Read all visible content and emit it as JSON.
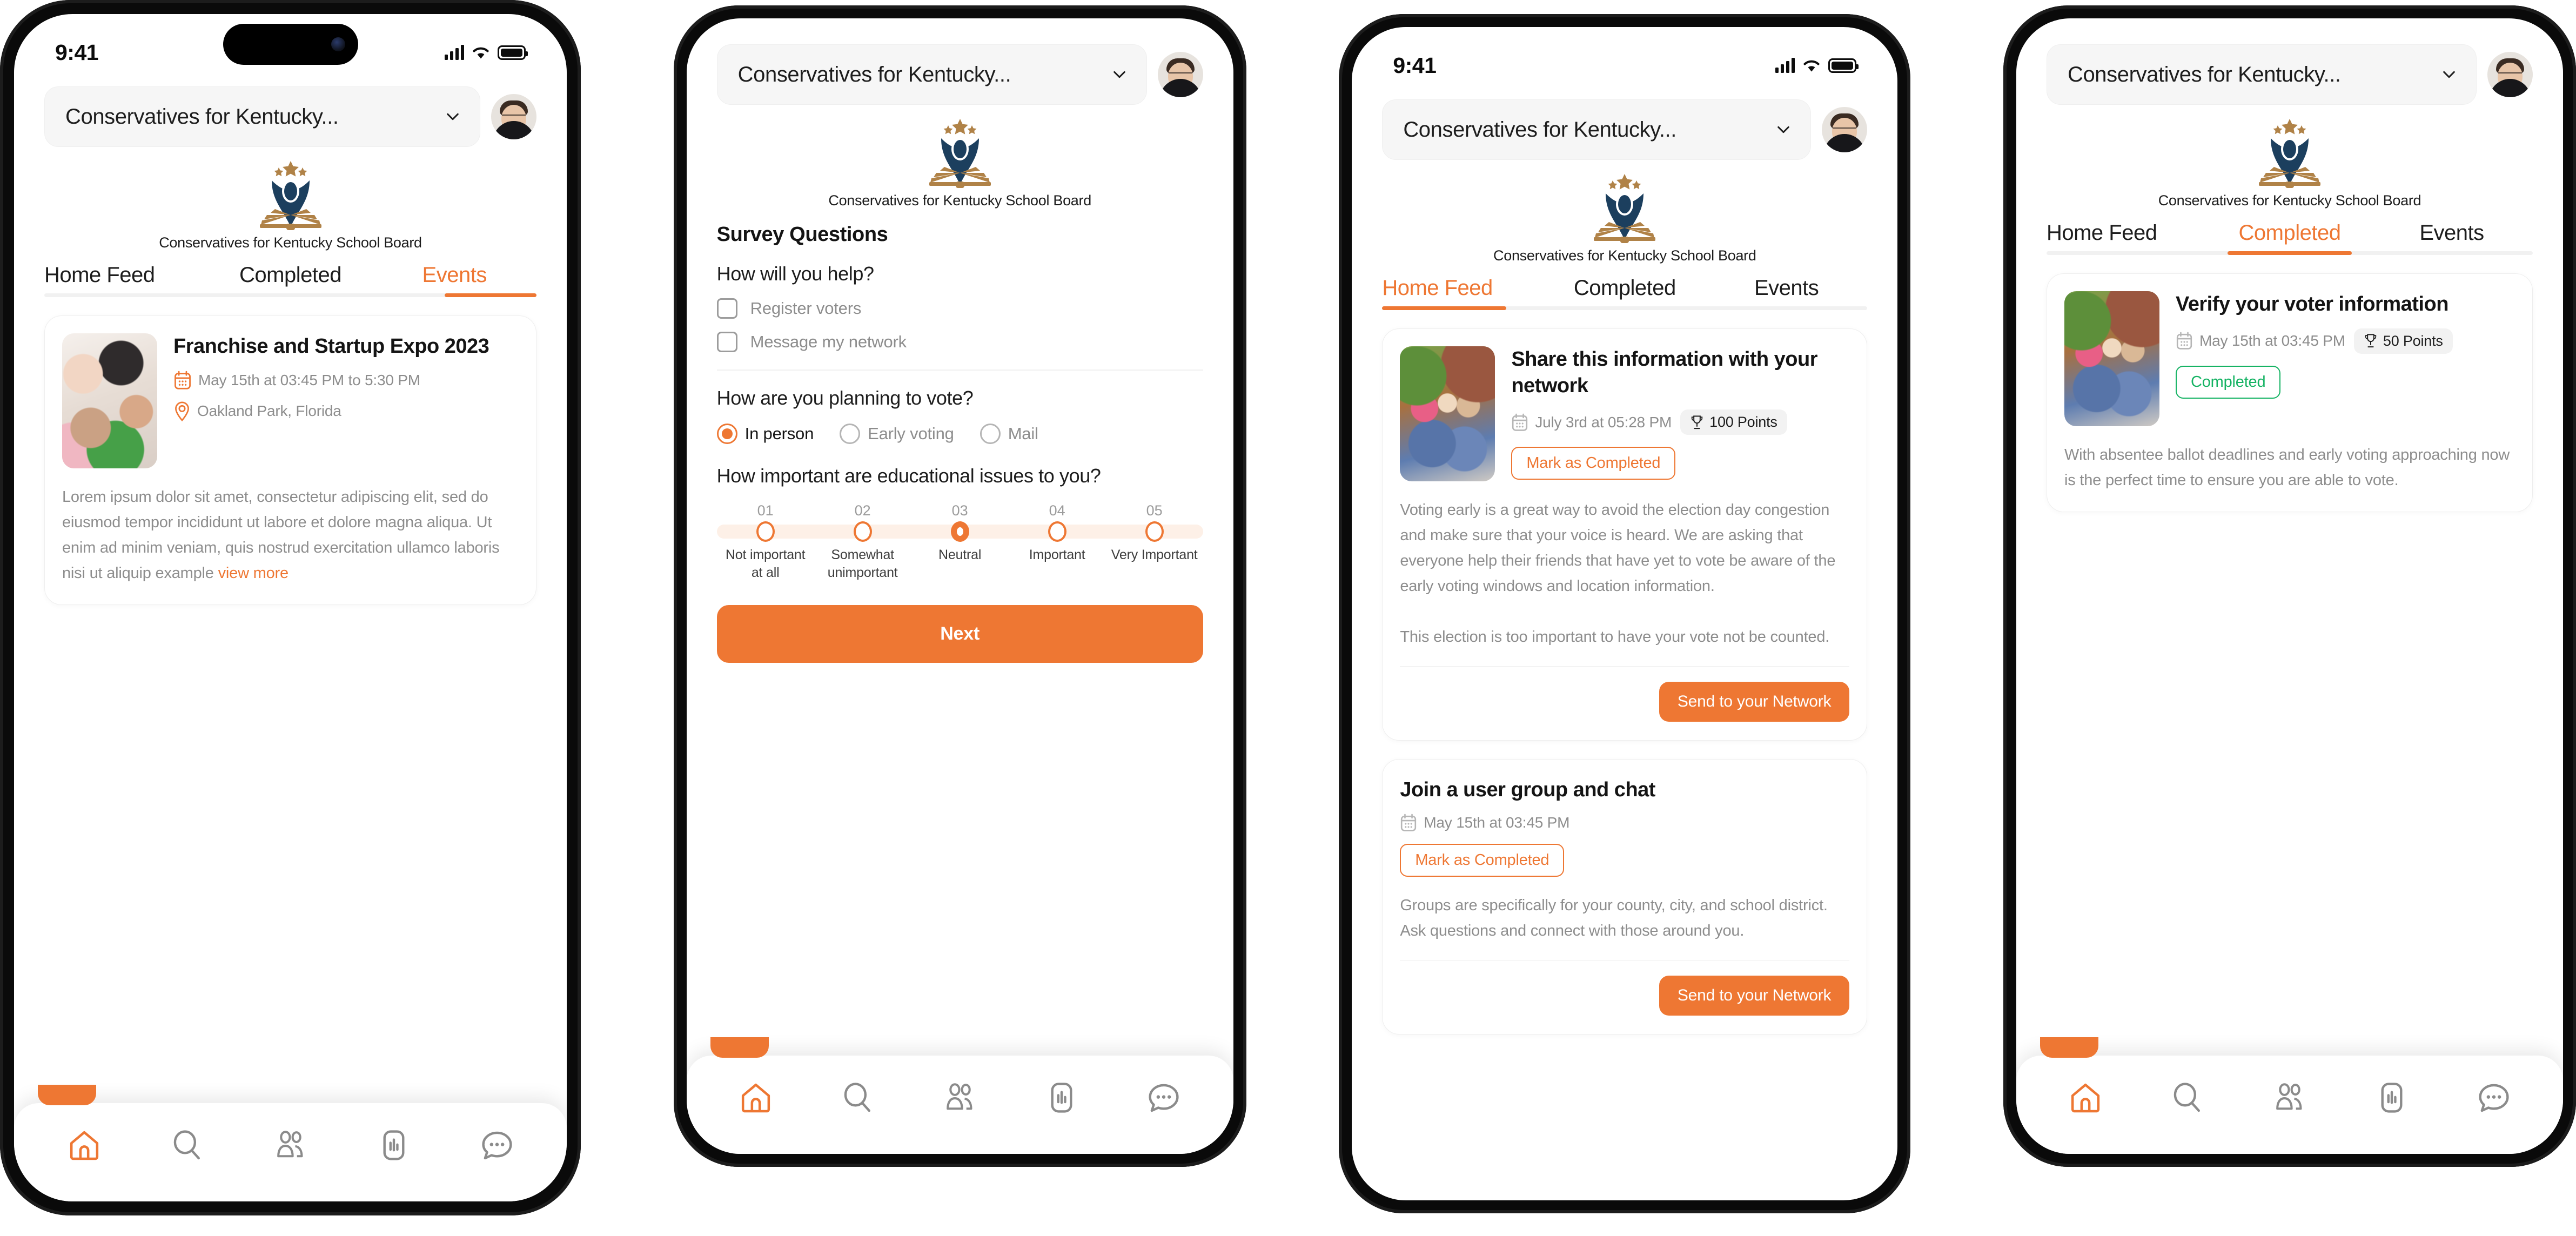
{
  "brand": {
    "org_short": "Conservatives for Kentucky...",
    "org_full": "Conservatives for Kentucky School Board",
    "accent": "#ee7733",
    "logo_navy": "#1c3f5e",
    "logo_gold": "#b08247",
    "success": "#16b364"
  },
  "status_bar": {
    "time": "9:41"
  },
  "tabs": {
    "home_feed": "Home Feed",
    "completed": "Completed",
    "events": "Events"
  },
  "bottom_nav": [
    {
      "name": "home",
      "label": "Home"
    },
    {
      "name": "search",
      "label": "Search"
    },
    {
      "name": "people",
      "label": "Groups"
    },
    {
      "name": "stats",
      "label": "Stats"
    },
    {
      "name": "chat",
      "label": "Messages"
    }
  ],
  "phone1": {
    "active_tab": "Events",
    "event": {
      "title": "Franchise and  Startup Expo 2023",
      "date": "May 15th at 03:45 PM to 5:30 PM",
      "location": "Oakland Park, Florida",
      "description": "Lorem ipsum dolor sit amet, consectetur adipiscing elit, sed do eiusmod tempor incididunt ut labore et dolore magna aliqua. Ut enim ad minim veniam, quis nostrud exercitation ullamco laboris nisi ut aliquip example ",
      "view_more": "view more"
    }
  },
  "phone2": {
    "survey_heading": "Survey Questions",
    "q1": {
      "title": "How will you help?",
      "options": [
        {
          "label": "Register voters",
          "checked": false
        },
        {
          "label": "Message my network",
          "checked": false
        }
      ]
    },
    "q2": {
      "title": "How are you planning to vote?",
      "options": [
        {
          "label": "In person",
          "selected": true
        },
        {
          "label": "Early voting",
          "selected": false
        },
        {
          "label": "Mail",
          "selected": false
        }
      ]
    },
    "q3": {
      "title": "How important are educational issues to you?",
      "numbers": [
        "01",
        "02",
        "03",
        "04",
        "05"
      ],
      "labels": [
        "Not important at all",
        "Somewhat unimportant",
        "Neutral",
        "Important",
        "Very Important"
      ],
      "selected_index": 2
    },
    "next_label": "Next"
  },
  "phone3": {
    "active_tab": "Home Feed",
    "cards": [
      {
        "title": "Share this information with your network",
        "date": "July 3rd at 05:28 PM",
        "points": "100 Points",
        "action_label": "Mark as Completed",
        "description": "Voting early is a great way to avoid the election day congestion and make sure that your voice is heard. We are asking that everyone help their friends that have yet to vote be aware of the early voting windows and location information.\n\nThis election is too important to have your vote not be counted.",
        "primary_label": "Send to your Network"
      },
      {
        "title": "Join a user group and chat",
        "date": "May 15th at 03:45 PM",
        "points": "",
        "action_label": "Mark as Completed",
        "description": "Groups are specifically for your county, city, and school district. Ask questions and connect with those around you.",
        "primary_label": "Send to your Network"
      }
    ]
  },
  "phone4": {
    "active_tab": "Completed",
    "card": {
      "title": "Verify your voter information",
      "date": "May 15th at 03:45 PM",
      "points": "50 Points",
      "status_label": "Completed",
      "description": "With absentee ballot deadlines and early voting approaching now is the perfect time to ensure you are able to vote."
    }
  }
}
